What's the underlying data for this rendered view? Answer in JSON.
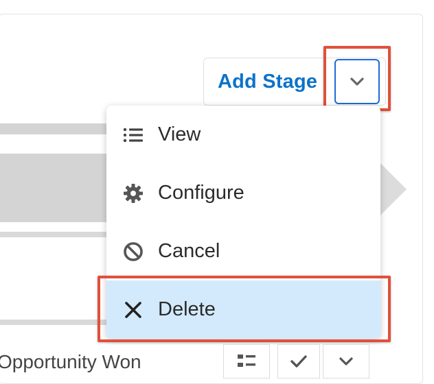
{
  "header": {
    "add_stage_label": "Add Stage"
  },
  "menu": {
    "items": [
      {
        "label": "View",
        "icon": "list-icon"
      },
      {
        "label": "Configure",
        "icon": "gear-icon"
      },
      {
        "label": "Cancel",
        "icon": "ban-icon"
      },
      {
        "label": "Delete",
        "icon": "close-icon",
        "selected": true
      }
    ]
  },
  "stage": {
    "label": "Opportunity Won"
  },
  "colors": {
    "link": "#0b73c9",
    "highlight": "#e0503a",
    "selected_bg": "#d3eafc",
    "focus_border": "#1f6bd3"
  }
}
